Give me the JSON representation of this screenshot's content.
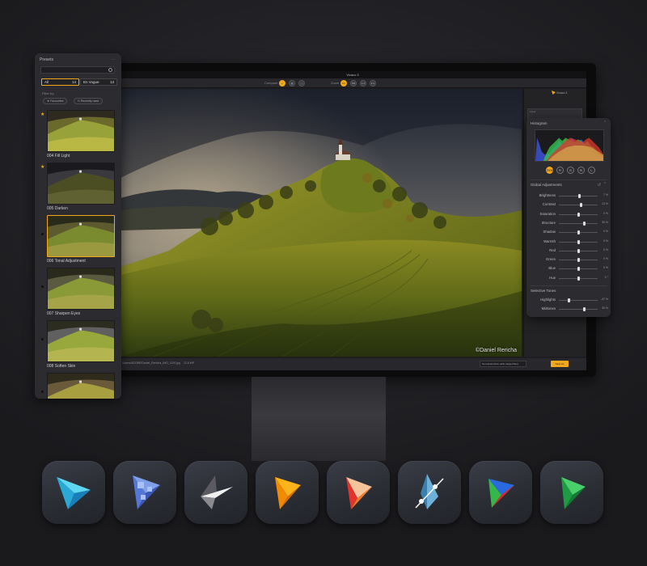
{
  "app": {
    "window_title": "Vivaco 3",
    "compare_label": "Compare",
    "zoom_label": "Zoom",
    "zoom_options": [
      "Fit",
      "Fill",
      "1:1",
      "2:1"
    ],
    "credit": "©Daniel Rericha"
  },
  "statusbar": {
    "path": "/Users/ADOBE/Daniel_Rericha_IMG_1100.jpg",
    "info": "12.5 MP",
    "nondestructive": "Non-destructive edits (target files)",
    "save_label": "Save As"
  },
  "right_strip": {
    "name": "Vivaco 3",
    "layer_label": "Layer"
  },
  "presets": {
    "title": "Presets",
    "tabs": [
      {
        "label": "All",
        "count": "14"
      },
      {
        "label": "En Vogue",
        "count": "13"
      }
    ],
    "filter_label": "Filter by:",
    "chips": [
      "Favourites",
      "Recently used"
    ],
    "items": [
      {
        "label": "004 Fill Light",
        "marker": "star"
      },
      {
        "label": "005 Darken",
        "marker": "star"
      },
      {
        "label": "006 Tonal Adjustment",
        "marker": "dot"
      },
      {
        "label": "007 Sharpen Eyes",
        "marker": "dot"
      },
      {
        "label": "008 Soften Skin",
        "marker": "dot"
      },
      {
        "label": "",
        "marker": "dot"
      }
    ]
  },
  "adjustments": {
    "histogram_title": "Histogram",
    "channels": [
      "RGB",
      "R",
      "G",
      "B",
      "L"
    ],
    "active_channel": "RGB",
    "global_title": "Global Adjustments",
    "global": [
      {
        "label": "Brightness",
        "value": "7 %",
        "level": 0.53
      },
      {
        "label": "Contrast",
        "value": "13 %",
        "level": 0.57
      },
      {
        "label": "Saturation",
        "value": "0 %",
        "level": 0.5
      },
      {
        "label": "Structure",
        "value": "30 %",
        "level": 0.65
      },
      {
        "label": "Shadow",
        "value": "0 %",
        "level": 0.5
      },
      {
        "label": "Warmth",
        "value": "0 %",
        "level": 0.5
      },
      {
        "label": "Red",
        "value": "0 %",
        "level": 0.5
      },
      {
        "label": "Green",
        "value": "0 %",
        "level": 0.5
      },
      {
        "label": "Blue",
        "value": "0 %",
        "level": 0.5
      },
      {
        "label": "Hue",
        "value": "0 °",
        "level": 0.5
      }
    ],
    "selective_title": "Selective Tones",
    "selective": [
      {
        "label": "Highlights",
        "value": "-47 %",
        "level": 0.27
      },
      {
        "label": "Midtones",
        "value": "30 %",
        "level": 0.65
      }
    ]
  },
  "dock_icons": [
    {
      "name": "app-icon-1"
    },
    {
      "name": "app-icon-2"
    },
    {
      "name": "app-icon-3"
    },
    {
      "name": "app-icon-4"
    },
    {
      "name": "app-icon-5"
    },
    {
      "name": "app-icon-6"
    },
    {
      "name": "app-icon-7"
    },
    {
      "name": "app-icon-8"
    }
  ],
  "colors": {
    "accent": "#f2a81a",
    "panel": "#2c2c30",
    "background": "#222226"
  }
}
